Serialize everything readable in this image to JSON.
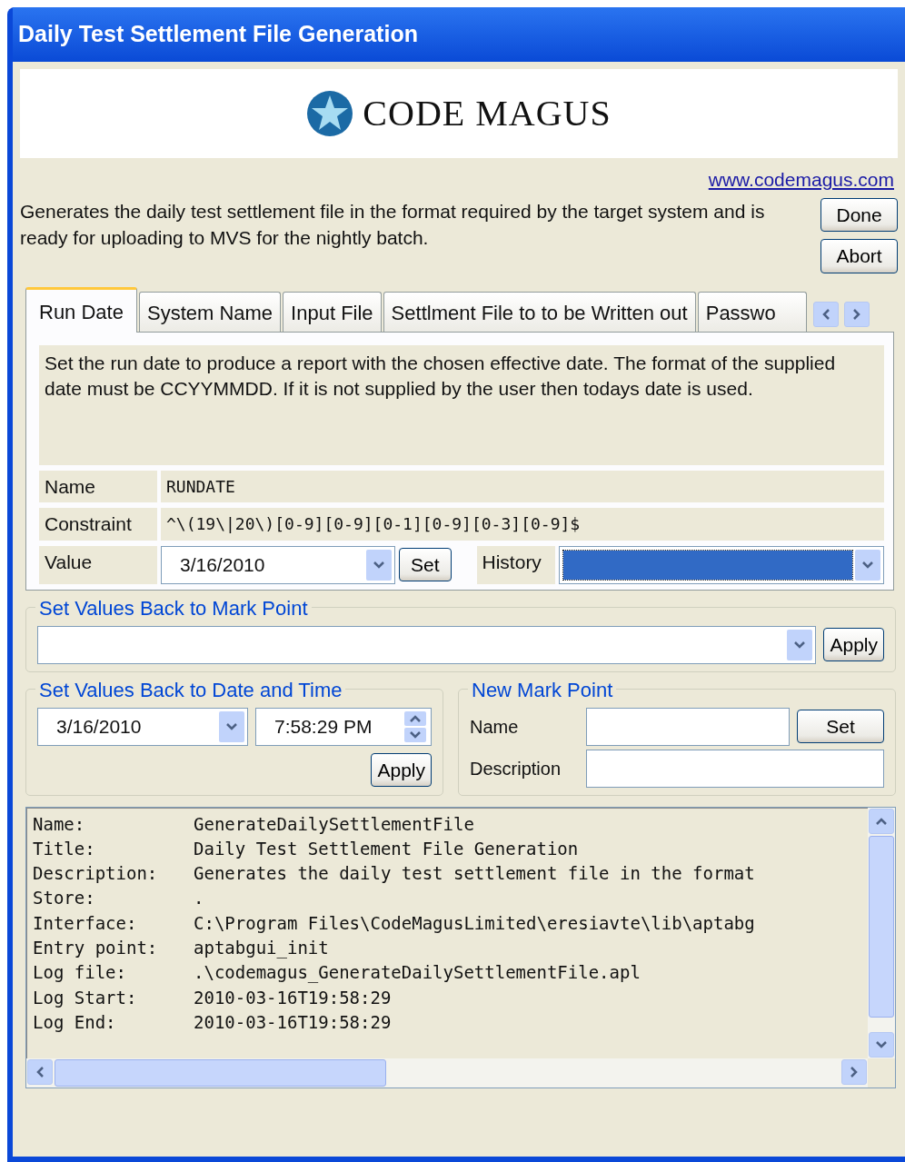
{
  "window": {
    "title": "Daily Test Settlement File Generation"
  },
  "logo": {
    "text": "CODE MAGUS"
  },
  "link": "www.codemagus.com",
  "description": "Generates the daily test settlement file in the format required by the target system and is ready for uploading to MVS for the nightly batch.",
  "buttons": [
    "Done",
    "Abort"
  ],
  "tabs": [
    {
      "label": "Run Date",
      "selected": true
    },
    {
      "label": "System Name",
      "selected": false
    },
    {
      "label": "Input File",
      "selected": false
    },
    {
      "label": "Settlment File to to be Written out",
      "selected": false
    },
    {
      "label": "Passwo",
      "selected": false
    }
  ],
  "tab_panel": {
    "help": "Set the run date to produce a report with the chosen effective date. The format of the supplied date must be CCYYMMDD. If it is not supplied by the user then todays date is used.",
    "name_label": "Name",
    "name": "RUNDATE",
    "constraint_label": "Constraint",
    "constraint": "^\\(19\\|20\\)[0-9][0-9][0-1][0-9][0-3][0-9]$",
    "value_label": "Value",
    "value": "3/16/2010",
    "set_button": "Set",
    "history_label": "History",
    "history_highlighted": true
  },
  "mark_point_restore": {
    "title": "Set Values Back to Mark Point",
    "button": "Apply"
  },
  "date_time_restore": {
    "title": "Set Values Back to Date and Time",
    "date": "3/16/2010",
    "time": "7:58:29 PM",
    "button": "Apply"
  },
  "new_mark_point": {
    "title": "New Mark Point",
    "name_label": "Name",
    "set_button": "Set",
    "description_label": "Description"
  },
  "log": [
    {
      "label": "Name:",
      "value": "GenerateDailySettlementFile"
    },
    {
      "label": "Title:",
      "value": "Daily Test Settlement File Generation"
    },
    {
      "label": "Description:",
      "value": "Generates the daily test settlement file in the format"
    },
    {
      "label": "Store:",
      "value": "."
    },
    {
      "label": "Interface:",
      "value": "C:\\Program Files\\CodeMagusLimited\\eresiavte\\lib\\aptabg"
    },
    {
      "label": "Entry point:",
      "value": "aptabgui_init"
    },
    {
      "label": "Log file:",
      "value": ".\\codemagus_GenerateDailySettlementFile.apl"
    },
    {
      "label": "Log Start:",
      "value": "2010-03-16T19:58:29"
    },
    {
      "label": "Log End:",
      "value": "2010-03-16T19:58:29"
    }
  ]
}
